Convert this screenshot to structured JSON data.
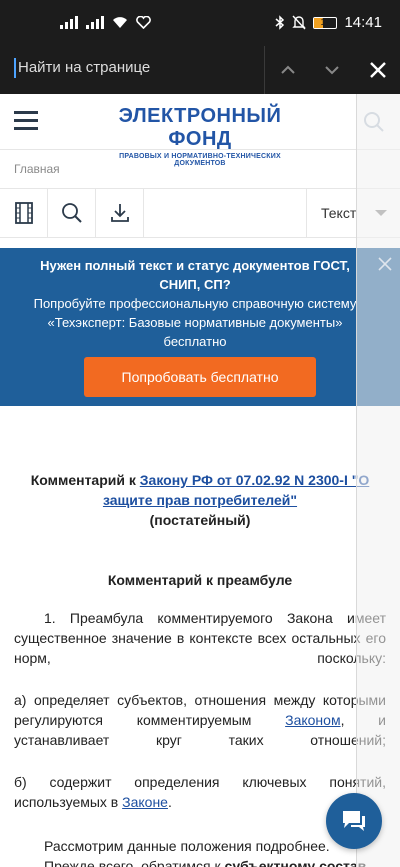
{
  "status_bar": {
    "time": "14:41",
    "battery": "17",
    "icons": [
      "signal-icon",
      "signal-icon",
      "wifi-icon",
      "heart-icon",
      "bluetooth-icon",
      "mute-icon",
      "battery-icon"
    ]
  },
  "find_bar": {
    "placeholder": "Найти на странице"
  },
  "header": {
    "logo_title": "ЭЛЕКТРОННЫЙ ФОНД",
    "logo_subtitle": "ПРАВОВЫХ И НОРМАТИВНО-ТЕХНИЧЕСКИХ ДОКУМЕНТОВ"
  },
  "breadcrumb": "Главная",
  "toolbar": {
    "select_value": "Текст"
  },
  "banner": {
    "title": "Нужен полный текст и статус документов ГОСТ, СНИП, СП?",
    "text": "Попробуйте профессиональную справочную систему «Техэксперт: Базовые нормативные документы» бесплатно",
    "button": "Попробовать бесплатно"
  },
  "article": {
    "title_prefix": "Комментарий к ",
    "title_link": "Закону РФ от 07.02.92 N 2300-I \"О защите прав потребителей\"",
    "title_suffix": "(постатейный)",
    "section_title": "Комментарий к преамбуле",
    "p1": "1. Преамбула комментируемого Закона имеет существенное значение в контексте всех остальных его норм, поскольку:",
    "p2_text": "а) определяет субъектов, отношения между которыми регулируются комментируемым ",
    "p2_link": "Законом",
    "p2_tail": ", и устанавливает круг таких отношений;",
    "p3_text": "б) содержит определения ключевых понятий, используемых в ",
    "p3_link": "Законе",
    "p3_tail": ".",
    "p4_text": "Рассмотрим данные положения подробнее.",
    "p5_text": "Прежде всего, обратимся к ",
    "p5_bold": "субъектному состав"
  }
}
